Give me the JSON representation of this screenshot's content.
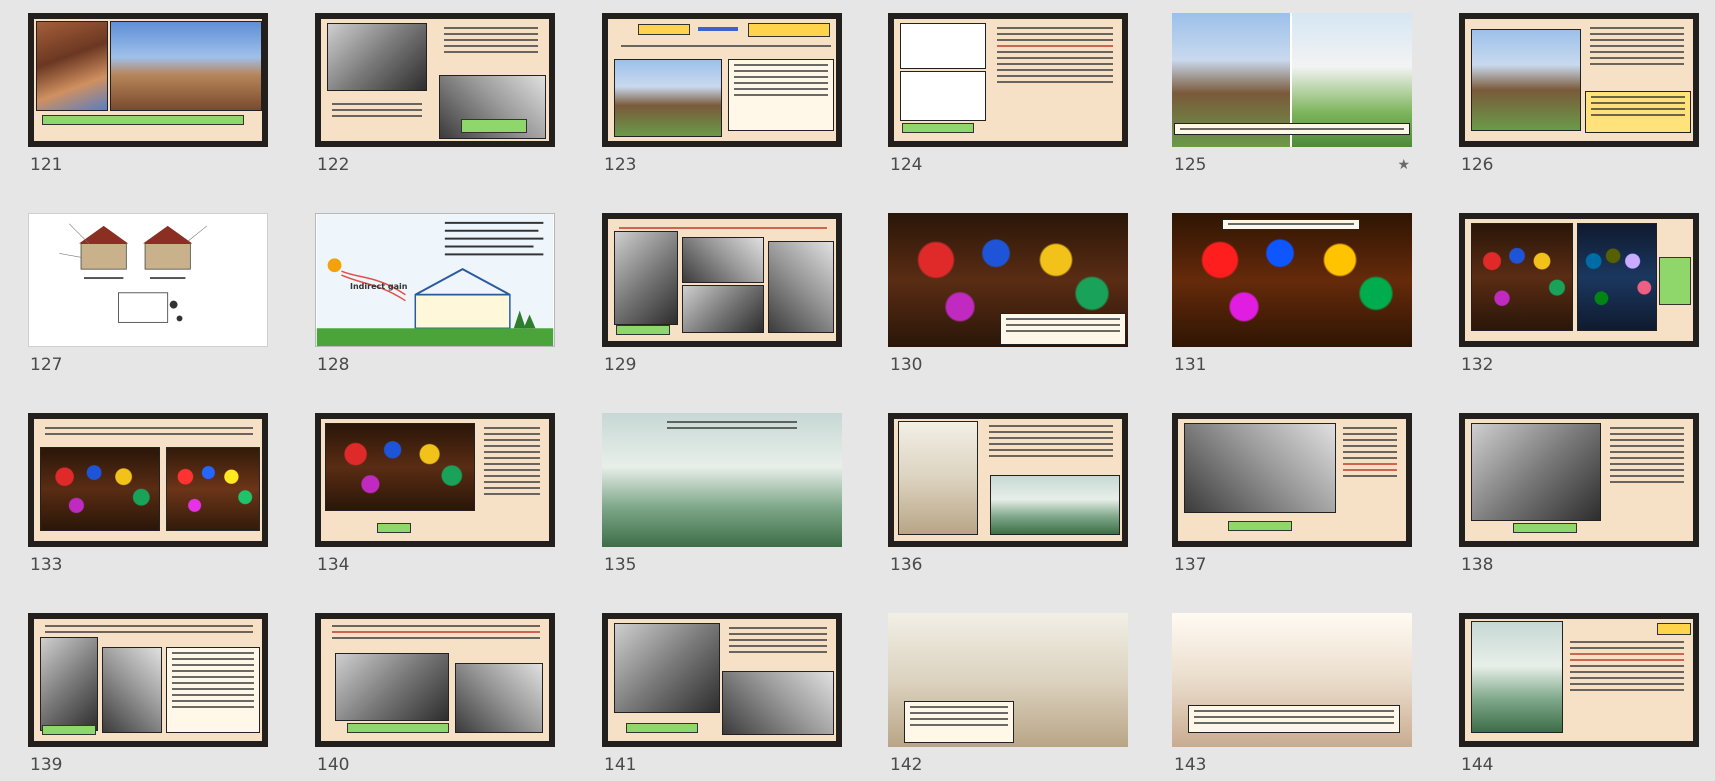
{
  "slides": [
    {
      "number": "121",
      "starred": false,
      "caption": "",
      "thumb_text": [
        "Indirect gain"
      ]
    },
    {
      "number": "122",
      "starred": false
    },
    {
      "number": "123",
      "starred": false
    },
    {
      "number": "124",
      "starred": false
    },
    {
      "number": "125",
      "starred": true
    },
    {
      "number": "126",
      "starred": false
    },
    {
      "number": "127",
      "starred": false
    },
    {
      "number": "128",
      "starred": false,
      "diagram_label": "Indirect gain"
    },
    {
      "number": "129",
      "starred": false
    },
    {
      "number": "130",
      "starred": false
    },
    {
      "number": "131",
      "starred": false
    },
    {
      "number": "132",
      "starred": false
    },
    {
      "number": "133",
      "starred": false
    },
    {
      "number": "134",
      "starred": false
    },
    {
      "number": "135",
      "starred": false
    },
    {
      "number": "136",
      "starred": false
    },
    {
      "number": "137",
      "starred": false
    },
    {
      "number": "138",
      "starred": false
    },
    {
      "number": "139",
      "starred": false
    },
    {
      "number": "140",
      "starred": false
    },
    {
      "number": "141",
      "starred": false
    },
    {
      "number": "142",
      "starred": false
    },
    {
      "number": "143",
      "starred": false
    },
    {
      "number": "144",
      "starred": false
    }
  ],
  "star_glyph": "★",
  "colors": {
    "background": "#e6e6e6",
    "slide_frame": "#231f1c",
    "slide_panel": "#f6e1c6",
    "caption_green": "#8fd66b",
    "title_yellow": "#ffd34a"
  }
}
